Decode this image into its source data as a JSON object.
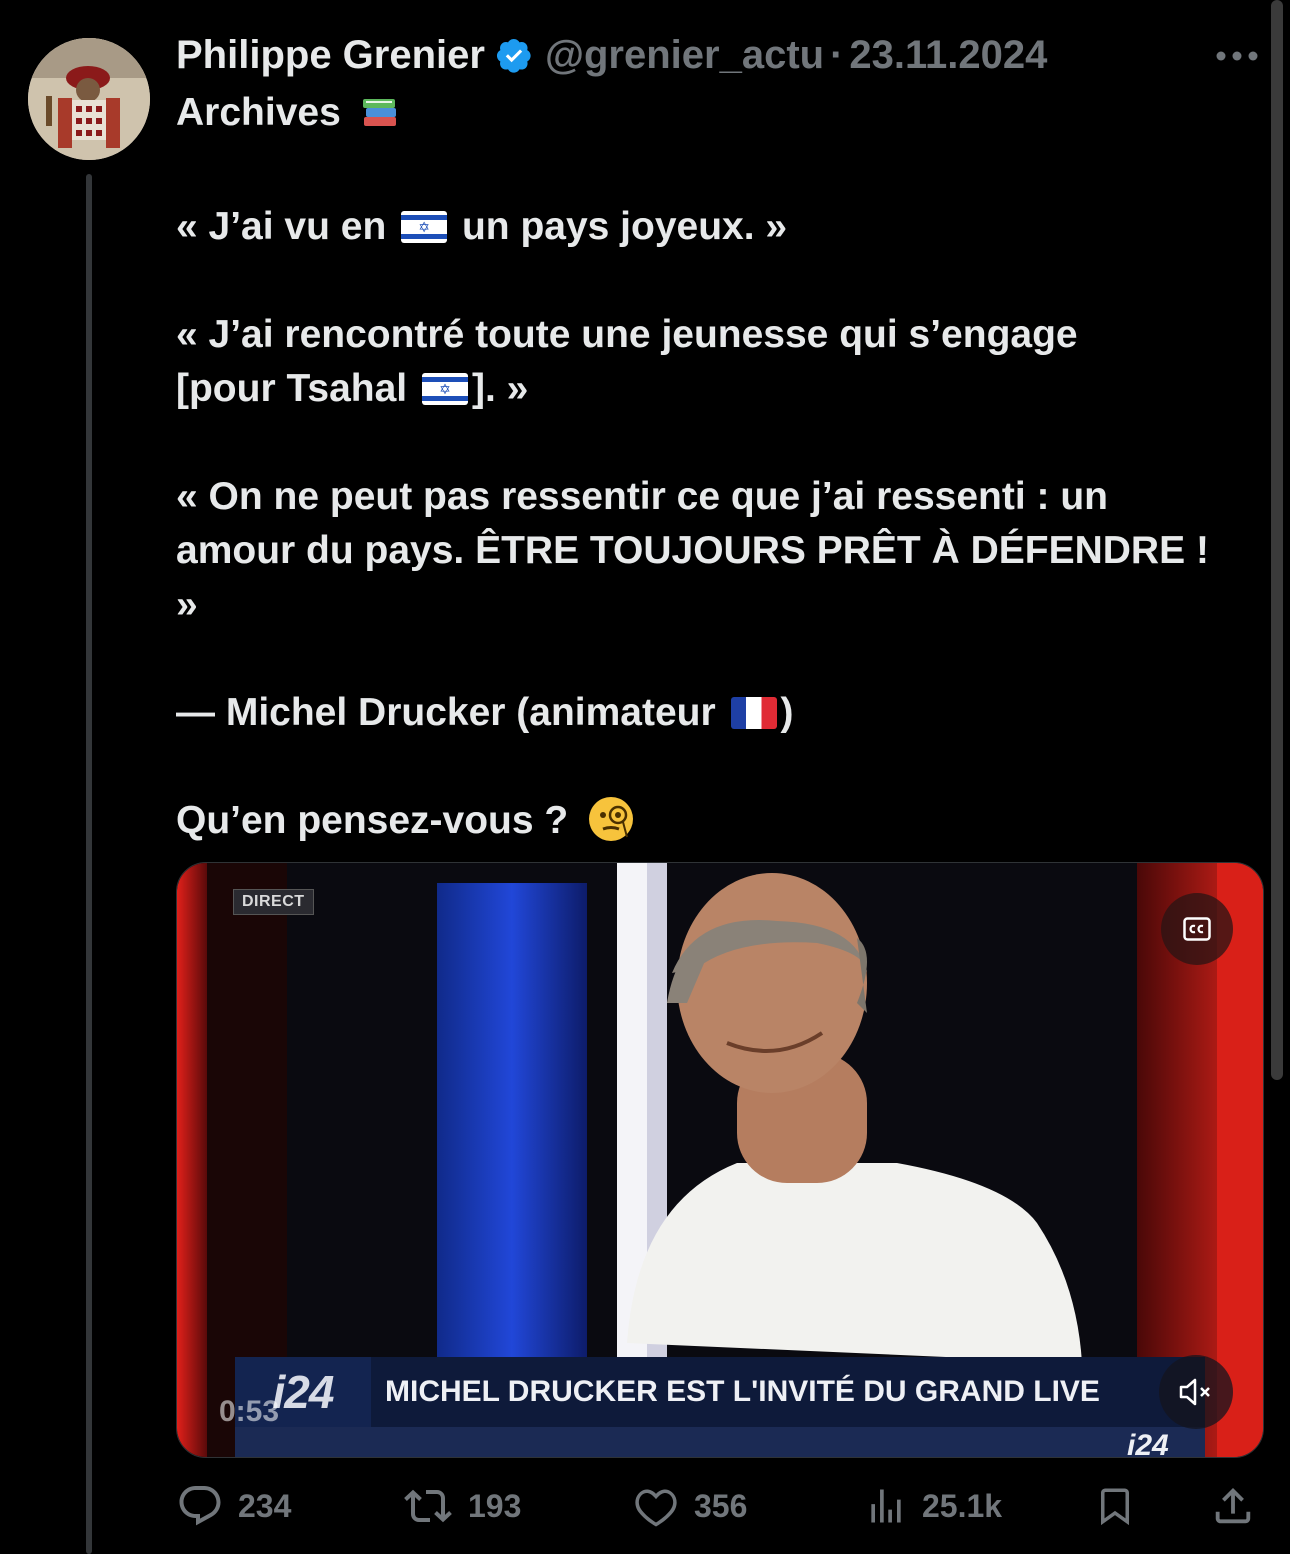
{
  "tweet": {
    "author_name": "Philippe Grenier",
    "handle": "@grenier_actu",
    "separator": "·",
    "date": "23.11.2024",
    "lines": {
      "l1": "Archives",
      "q1a": "« J’ai vu en",
      "q1b": "un pays joyeux. »",
      "q2a": "« J’ai rencontré toute une jeunesse qui s’engage",
      "q2b": "[pour Tsahal",
      "q2c": "]. »",
      "q3a": "« On ne peut pas ressentir ce que j’ai ressenti : un",
      "q3b": "amour du pays. ÊTRE TOUJOURS PRÊT À DÉFENDRE !",
      "q3c": "»",
      "attr_a": "— Michel Drucker (animateur",
      "attr_b": ")",
      "question": "Qu’en pensez-vous ?"
    }
  },
  "video": {
    "direct_tag": "DIRECT",
    "channel_logo": "i24",
    "caption": "MICHEL DRUCKER EST L'INVITÉ DU GRAND LIVE",
    "small_logo": "i24",
    "time": "0:53",
    "cc_icon": "closed-captions-icon",
    "mute_icon": "muted-speaker-icon"
  },
  "actions": {
    "replies": "234",
    "reposts": "193",
    "likes": "356",
    "views": "25.1k"
  },
  "colors": {
    "background": "#000000",
    "text": "#e7e9ea",
    "muted": "#71767b",
    "verified": "#1d9bf0"
  }
}
